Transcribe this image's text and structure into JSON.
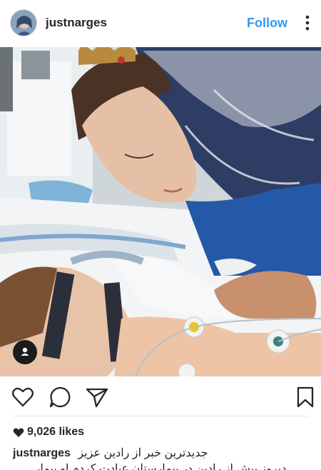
{
  "header": {
    "username": "justnarges",
    "follow_label": "Follow",
    "more_icon": "more-vertical-icon"
  },
  "photo": {
    "tag_icon": "user-tag-icon"
  },
  "actions": {
    "like_icon": "heart-icon",
    "comment_icon": "comment-icon",
    "share_icon": "send-icon",
    "save_icon": "bookmark-icon"
  },
  "likes": {
    "count_text": "9,026 likes"
  },
  "caption": {
    "username": "justnarges",
    "text": "جدیدترین خبر از رادین عزیز",
    "second_line": "دیروز پیش از رادین در بیمارستان عیادت کردم او بیمار"
  },
  "colors": {
    "accent": "#3897f0",
    "text": "#262626"
  }
}
